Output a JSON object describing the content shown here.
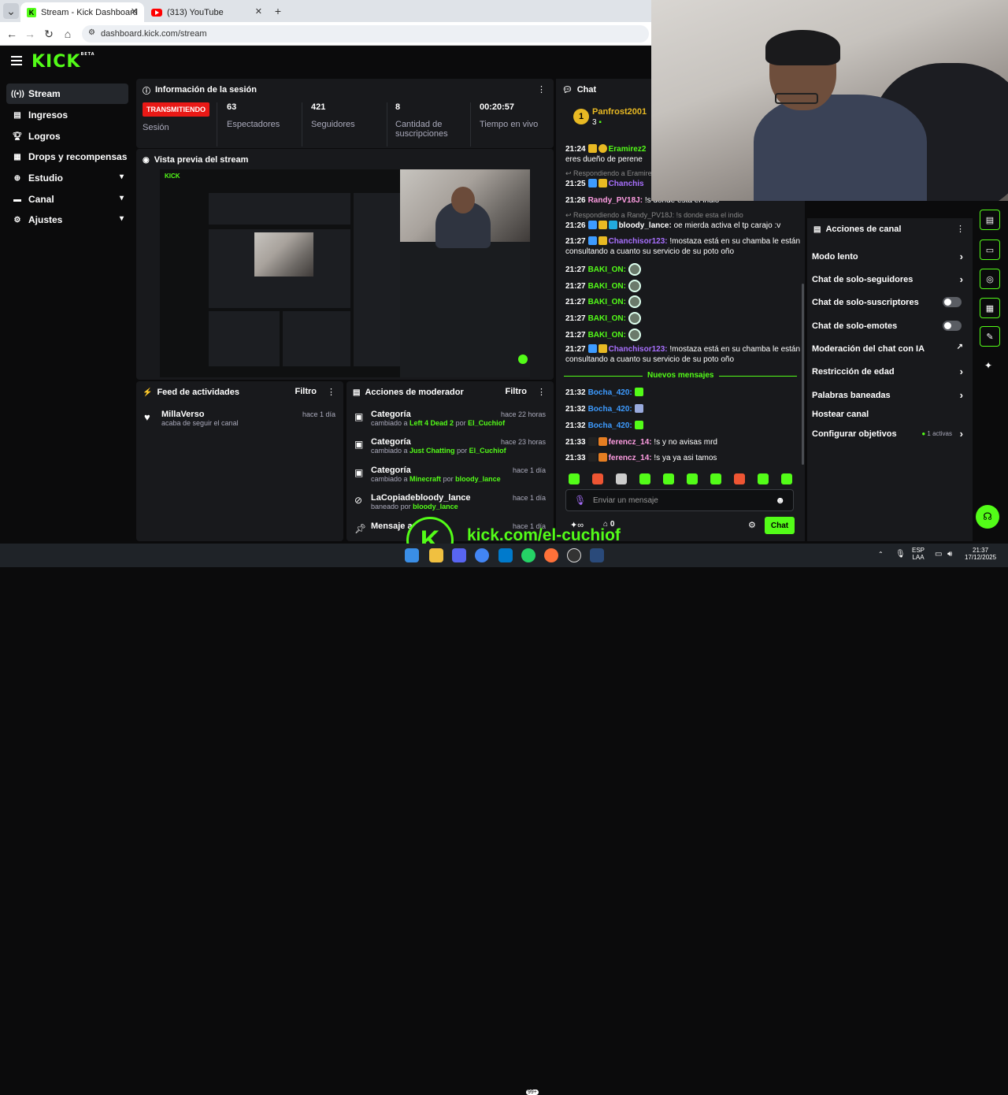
{
  "browser": {
    "tabs": [
      {
        "title": "Stream - Kick Dashboard",
        "active": true
      },
      {
        "title": "(313) YouTube",
        "active": false
      }
    ],
    "url": "dashboard.kick.com/stream"
  },
  "brand": {
    "logo": "KICK",
    "logo_sup": "BETA",
    "accent": "#53fc18"
  },
  "sidebar": {
    "items": [
      {
        "label": "Stream",
        "icon": "broadcast-icon"
      },
      {
        "label": "Ingresos",
        "icon": "chart-icon"
      },
      {
        "label": "Logros",
        "icon": "trophy-icon"
      },
      {
        "label": "Drops y recompensas",
        "icon": "gift-icon"
      },
      {
        "label": "Estudio",
        "icon": "studio-icon"
      },
      {
        "label": "Canal",
        "icon": "channel-icon"
      },
      {
        "label": "Ajustes",
        "icon": "gear-icon"
      }
    ]
  },
  "session": {
    "title": "Información de la sesión",
    "live_badge": "TRANSMITIENDO",
    "live_label": "Sesión",
    "stats": [
      {
        "value": "63",
        "label": "Espectadores"
      },
      {
        "value": "421",
        "label": "Seguidores"
      },
      {
        "value": "8",
        "label": "Cantidad de suscripciones"
      },
      {
        "value": "00:20:57",
        "label": "Tiempo en vivo"
      }
    ]
  },
  "preview": {
    "title": "Vista previa del stream",
    "watermark": "kick.com/el-cuchiof"
  },
  "feed": {
    "title": "Feed de actividades",
    "filter": "Filtro",
    "items": [
      {
        "user": "MillaVerso",
        "action": "acaba de seguir el canal",
        "time": "hace 1 día"
      }
    ]
  },
  "moderator": {
    "title": "Acciones de moderador",
    "filter": "Filtro",
    "items": [
      {
        "title": "Categoría",
        "pre": "cambiado a",
        "target": "Left 4 Dead 2",
        "mid": "por",
        "by": "El_Cuchiof",
        "time": "hace 22 horas"
      },
      {
        "title": "Categoría",
        "pre": "cambiado a",
        "target": "Just Chatting",
        "mid": "por",
        "by": "El_Cuchiof",
        "time": "hace 23 horas"
      },
      {
        "title": "Categoría",
        "pre": "cambiado a",
        "target": "Minecraft",
        "mid": "por",
        "by": "bloody_lance",
        "time": "hace 1 día"
      },
      {
        "title": "LaCopiadebloody_lance",
        "pre": "baneado",
        "target": "",
        "mid": "por",
        "by": "bloody_lance",
        "time": "hace 1 día"
      },
      {
        "title": "Mensaje anclado",
        "pre": "",
        "target": "",
        "mid": "",
        "by": "",
        "time": "hace 1 día"
      }
    ]
  },
  "chat": {
    "title": "Chat",
    "top_user": {
      "rank": "1",
      "name": "Panfrost2001",
      "count": "3"
    },
    "new_messages": "Nuevos mensajes",
    "messages": [
      {
        "time": "21:24",
        "user": "Eramirez2",
        "text": "eres dueño de perene"
      },
      {
        "reply": "Respondiendo a Eramirez"
      },
      {
        "time": "21:25",
        "user": "Chanchis",
        "text": ""
      },
      {
        "time": "21:26",
        "user": "Randy_PV18J:",
        "text": "!s donde esta el indio"
      },
      {
        "reply": "Respondiendo a Randy_PV18J: !s donde esta el indio"
      },
      {
        "time": "21:26",
        "user": "bloody_lance:",
        "text": "oe mierda activa el tp carajo :v"
      },
      {
        "time": "21:27",
        "user": "Chanchisor123:",
        "text": "!mostaza está en su chamba le están consultando a cuanto su servicio de su poto oño"
      },
      {
        "time": "21:27",
        "user": "BAKI_ON:",
        "text": ""
      },
      {
        "time": "21:27",
        "user": "BAKI_ON:",
        "text": ""
      },
      {
        "time": "21:27",
        "user": "BAKI_ON:",
        "text": ""
      },
      {
        "time": "21:27",
        "user": "BAKI_ON:",
        "text": ""
      },
      {
        "time": "21:27",
        "user": "BAKI_ON:",
        "text": ""
      },
      {
        "time": "21:27",
        "user": "Chanchisor123:",
        "text": "!mostaza está en su chamba le están consultando a cuanto su servicio de su poto oño"
      },
      {
        "time": "21:32",
        "user": "Bocha_420:",
        "text": ""
      },
      {
        "time": "21:32",
        "user": "Bocha_420:",
        "text": ""
      },
      {
        "time": "21:32",
        "user": "Bocha_420:",
        "text": ""
      },
      {
        "time": "21:33",
        "user": "ferencz_14:",
        "text": "!s y no avisas mrd"
      },
      {
        "time": "21:33",
        "user": "ferencz_14:",
        "text": "!s ya ya asi tamos"
      }
    ],
    "input_placeholder": "Enviar un mensaje",
    "viewers": "0",
    "send": "Chat"
  },
  "channel_actions": {
    "title": "Acciones de canal",
    "items": [
      {
        "label": "Modo lento",
        "control": "chevron"
      },
      {
        "label": "Chat de solo-seguidores",
        "control": "chevron"
      },
      {
        "label": "Chat de solo-suscriptores",
        "control": "toggle"
      },
      {
        "label": "Chat de solo-emotes",
        "control": "toggle"
      },
      {
        "label": "Moderación del chat con IA",
        "control": "external"
      },
      {
        "label": "Restricción de edad",
        "control": "chevron"
      },
      {
        "label": "Palabras baneadas",
        "control": "chevron"
      },
      {
        "label": "Hostear canal",
        "control": "none"
      },
      {
        "label": "Configurar objetivos",
        "control": "chevron",
        "extra": "1 activas"
      }
    ]
  },
  "overlay": {
    "text": "kick.com/el-cuchiof"
  },
  "taskbar": {
    "lang": "ESP",
    "lang2": "LAA",
    "time": "21:37",
    "date": "17/12/2025",
    "badge": "99+"
  }
}
